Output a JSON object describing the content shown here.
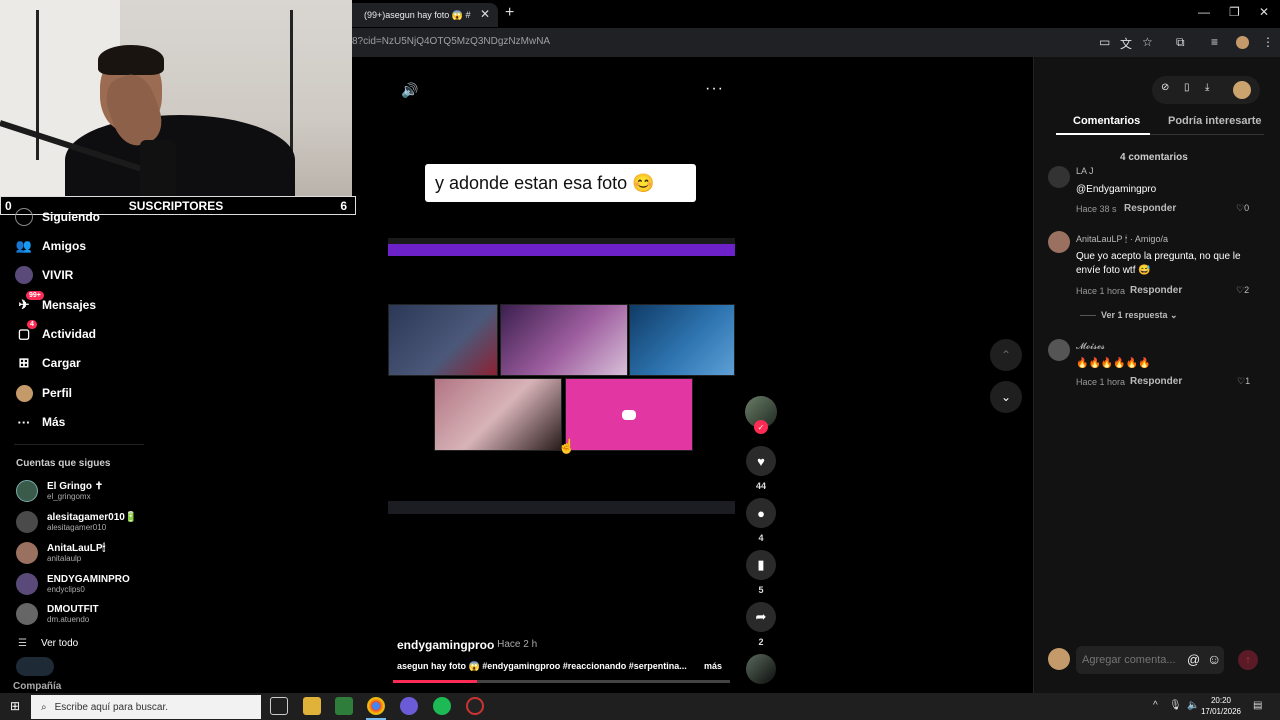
{
  "browser": {
    "tab_title": "(99+)asegun hay foto 😱 #",
    "tab_close": "✕",
    "new_tab": "+",
    "url": "8?cid=NzU5NjQ4OTQ5MzQ3NDgzNzMwNA",
    "win_minimize": "—",
    "win_restore": "❐",
    "win_close": "✕"
  },
  "webcam": {
    "subs_left": "0",
    "subs_label": "SUSCRIPTORES",
    "subs_right": "6"
  },
  "sidebar": {
    "items": [
      {
        "label": "Siguiendo",
        "icon": "following-icon"
      },
      {
        "label": "Amigos",
        "icon": "friends-icon"
      },
      {
        "label": "VIVIR",
        "icon": "live-icon"
      },
      {
        "label": "Mensajes",
        "icon": "messages-icon",
        "badge": "99+"
      },
      {
        "label": "Actividad",
        "icon": "activity-icon",
        "badge": "4"
      },
      {
        "label": "Cargar",
        "icon": "upload-icon"
      },
      {
        "label": "Perfil",
        "icon": "profile-icon"
      },
      {
        "label": "Más",
        "icon": "more-icon"
      }
    ],
    "following_title": "Cuentas que sigues",
    "following": [
      {
        "name": "El Gringo ✝",
        "handle": "el_gringomx",
        "color": "#3a5a4a"
      },
      {
        "name": "alesitagamer010🔋",
        "handle": "alesitagamer010",
        "color": "#4a4a4a"
      },
      {
        "name": "AnitaLauLP🕯",
        "handle": "anitalaulp",
        "color": "#9a7060"
      },
      {
        "name": "ENDYGAMINPRO",
        "handle": "endyclips0",
        "color": "#5a4a7a"
      },
      {
        "name": "DMOUTFIT",
        "handle": "dm.atuendo",
        "color": "#666666"
      }
    ],
    "see_all": "Ver todo",
    "company": "Compañía"
  },
  "video": {
    "caption": "y adonde estan esa foto 😊",
    "author": "endygamingproo",
    "time": "· Hace 2 h",
    "description": "asegun hay foto 😱 #endygamingproo #reaccionando #serpentina...",
    "more": "más",
    "progress": 0.25
  },
  "actions": {
    "likes": "44",
    "comments": "4",
    "saves": "5",
    "shares": "2"
  },
  "comments_panel": {
    "tab_comments": "Comentarios",
    "tab_interest": "Podría interesarte",
    "count": "4 comentarios",
    "comments": [
      {
        "user": "LA J",
        "text": "@Endygamingpro",
        "time": "Hace 38 s",
        "reply": "Responder",
        "likes": "0",
        "avatar_color": "#333333"
      },
      {
        "user": "AnitaLauLP 🕯 · Amigo/a",
        "text": "Que yo acepto la pregunta, no que le envíe foto wtf 😅",
        "time": "Hace 1 hora",
        "reply": "Responder",
        "likes": "2",
        "view_replies": "Ver 1 respuesta ⌄",
        "avatar_color": "#9a7060"
      },
      {
        "user": "𝓜𝓸𝓲𝓼𝓮𝓼",
        "text": "🔥🔥🔥🔥🔥🔥",
        "time": "Hace 1 hora",
        "reply": "Responder",
        "likes": "1",
        "avatar_color": "#555555"
      }
    ],
    "input_placeholder": "Agregar comenta..."
  },
  "taskbar": {
    "search_placeholder": "Escribe aquí para buscar.",
    "time": "20:20",
    "date": "17/01/2026"
  }
}
